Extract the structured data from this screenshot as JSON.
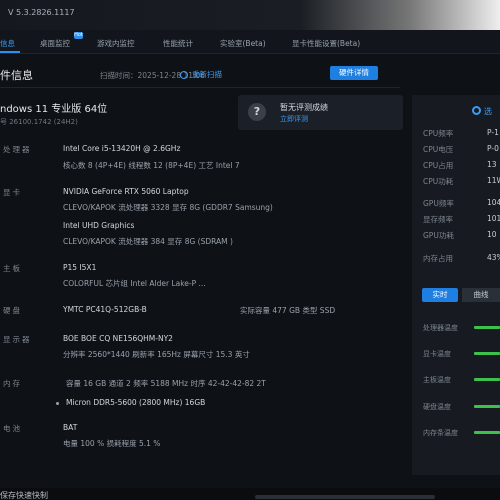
{
  "app": {
    "version": "V 5.3.2826.1117"
  },
  "nav": {
    "items": [
      {
        "label": "信息"
      },
      {
        "label": "桌面监控"
      },
      {
        "label": "游戏内监控"
      },
      {
        "label": "性能统计"
      },
      {
        "label": "实验室(Beta)"
      },
      {
        "label": "显卡性能设置(Beta)"
      }
    ],
    "hot_badge": "Hot"
  },
  "header": {
    "title": "件信息",
    "scan_time": "扫描时间：2025-12-28 11:06",
    "rescan": "重新扫描",
    "hw_detail_button": "硬件详情"
  },
  "os": {
    "name": "ndows 11 专业版 64位",
    "version": "号 26100.1742 (24H2)"
  },
  "evaluation": {
    "title": "暂无评测成绩",
    "link": "立即评测"
  },
  "hardware": {
    "cpu": {
      "label": "处理器",
      "name": "Intel Core i5-13420H @ 2.6GHz",
      "detail": "核心数 8 (4P+4E)    线程数 12 (8P+4E)    工艺 Intel 7"
    },
    "gpu": {
      "label": "显卡",
      "name1": "NVIDIA GeForce RTX 5060 Laptop",
      "detail1": "CLEVO/KAPOK    流处理器 3328    显存 8G (GDDR7 Samsung)",
      "name2": "Intel UHD Graphics",
      "detail2": "CLEVO/KAPOK    流处理器 384    显存 8G (SDRAM )"
    },
    "mainboard": {
      "label": "主板",
      "name": "P15 I5X1",
      "detail": "COLORFUL    芯片组 Intel Alder Lake-P ..."
    },
    "disk": {
      "label": "硬盘",
      "name": "YMTC PC41Q-512GB-B",
      "detail": "实际容量 477 GB    类型 SSD"
    },
    "monitor": {
      "label": "显示器",
      "name": "BOE BOE CQ NE156QHM-NY2",
      "detail": "分辨率 2560*1440    刷新率 165Hz    屏幕尺寸 15.3 英寸"
    },
    "memory": {
      "label": "内存",
      "detail": "容量 16 GB    通道 2    频率 5188 MHz    时序 42-42-42-82 2T",
      "module": "Micron DDR5-5600 (2800 MHz) 16GB"
    },
    "battery": {
      "label": "电池",
      "name": "BAT",
      "detail": "电量 100 %    损耗程度 5.1 %"
    }
  },
  "right_panel": {
    "select": "选",
    "stats": [
      {
        "label": "CPU频率",
        "value": "P-1"
      },
      {
        "label": "CPU电压",
        "value": "P-0"
      },
      {
        "label": "CPU占用",
        "value": "13"
      },
      {
        "label": "CPU功耗",
        "value": "11W"
      },
      {
        "label": "GPU频率",
        "value": "104"
      },
      {
        "label": "显存频率",
        "value": "101"
      },
      {
        "label": "GPU功耗",
        "value": "10"
      },
      {
        "label": "内存占用",
        "value": "43%"
      }
    ],
    "tabs": {
      "active": "实时",
      "inactive": "曲线"
    },
    "temps": [
      {
        "label": "处理器温度"
      },
      {
        "label": "显卡温度"
      },
      {
        "label": "主板温度"
      },
      {
        "label": "硬盘温度"
      },
      {
        "label": "内存条温度"
      }
    ]
  },
  "bottom": {
    "text": "保存快速快制"
  }
}
